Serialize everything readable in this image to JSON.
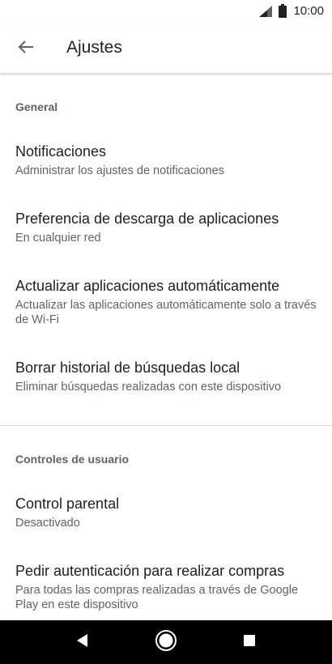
{
  "status_bar": {
    "time": "10:00",
    "icons": [
      "signal-icon",
      "battery-icon"
    ]
  },
  "app_bar": {
    "back_icon": "arrow-back-icon",
    "title": "Ajustes"
  },
  "sections": [
    {
      "header": "General",
      "items": [
        {
          "title": "Notificaciones",
          "subtitle": "Administrar los ajustes de notificaciones"
        },
        {
          "title": "Preferencia de descarga de aplicaciones",
          "subtitle": "En cualquier red"
        },
        {
          "title": "Actualizar aplicaciones automáticamente",
          "subtitle": "Actualizar las aplicaciones automáticamente solo a través de Wi-Fi"
        },
        {
          "title": "Borrar historial de búsquedas local",
          "subtitle": "Eliminar búsquedas realizadas con este dispositivo"
        }
      ]
    },
    {
      "header": "Controles de usuario",
      "items": [
        {
          "title": "Control parental",
          "subtitle": "Desactivado"
        },
        {
          "title": "Pedir autenticación para realizar compras",
          "subtitle": "Para todas las compras realizadas a través de Google Play en este dispositivo"
        }
      ]
    }
  ],
  "nav_bar": {
    "buttons": [
      "back-triangle-icon",
      "home-circle-icon",
      "recents-square-icon"
    ]
  },
  "colors": {
    "primary_text": "#202124",
    "secondary_text": "#5f6368",
    "divider": "#e0e0e0",
    "nav_bar": "#000000"
  }
}
